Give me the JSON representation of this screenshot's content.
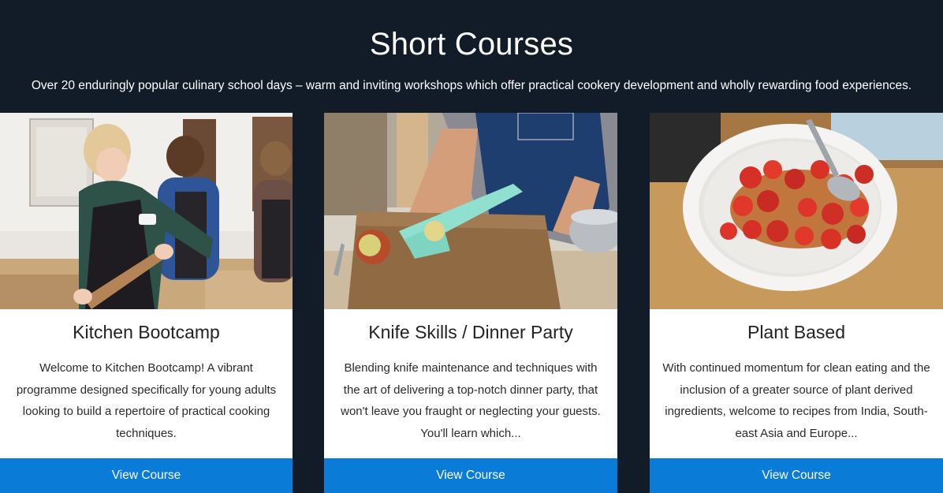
{
  "header": {
    "title": "Short Courses",
    "subtitle": "Over 20 enduringly popular culinary school days – warm and inviting workshops which offer practical cookery development and wholly rewarding food experiences."
  },
  "cards": [
    {
      "title": "Kitchen Bootcamp",
      "description": "Welcome to Kitchen Bootcamp! A vibrant programme designed specifically for young adults looking to build a repertoire of practical cooking techniques.",
      "button_label": "View Course"
    },
    {
      "title": "Knife Skills / Dinner Party",
      "description": "Blending knife maintenance and techniques with the art of delivering a top-notch dinner party, that won't leave you fraught or neglecting your guests. You'll learn which...",
      "button_label": "View Course"
    },
    {
      "title": "Plant Based",
      "description": "With continued momentum for clean eating and the inclusion of a greater source of plant derived ingredients, welcome to recipes from India, South-east Asia and Europe...",
      "button_label": "View Course"
    }
  ],
  "colors": {
    "background": "#121b28",
    "button": "#0a7bd6",
    "card": "#ffffff"
  }
}
